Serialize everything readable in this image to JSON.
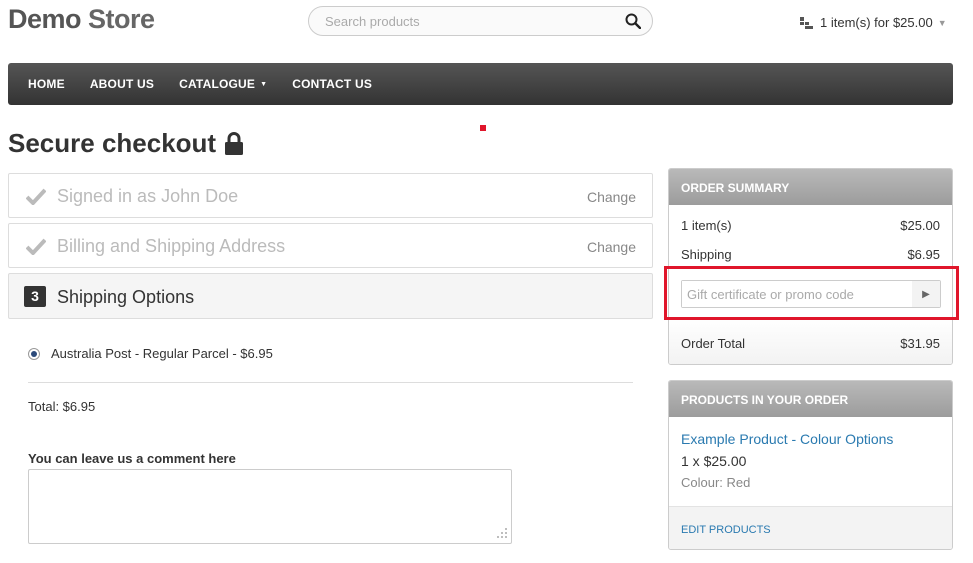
{
  "header": {
    "logo_demo": "Demo",
    "logo_store": "Store",
    "search_placeholder": "Search products",
    "cart_label": "1 item(s) for $25.00"
  },
  "nav": {
    "items": [
      "HOME",
      "ABOUT US",
      "CATALOGUE",
      "CONTACT US"
    ]
  },
  "checkout": {
    "title": "Secure checkout",
    "step1_label": "Signed in as John Doe",
    "step2_label": "Billing and Shipping Address",
    "change_label": "Change",
    "step3_number": "3",
    "step3_label": "Shipping Options",
    "shipping_option": "Australia Post - Regular Parcel - $6.95",
    "total": "Total: $6.95",
    "comment_label": "You can leave us a comment here",
    "comment_value": ""
  },
  "summary": {
    "title": "ORDER SUMMARY",
    "items_label": "1 item(s)",
    "items_value": "$25.00",
    "shipping_label": "Shipping",
    "shipping_value": "$6.95",
    "promo_placeholder": "Gift certificate or promo code",
    "total_label": "Order Total",
    "total_value": "$31.95"
  },
  "products": {
    "title": "PRODUCTS IN YOUR ORDER",
    "name": "Example Product - Colour Options",
    "qty": "1 x $25.00",
    "attr": "Colour: Red",
    "edit_label": "EDIT PRODUCTS"
  },
  "colors": {
    "accent": "#2a7ab0",
    "highlight": "#e0162b",
    "nav": "#444444"
  }
}
